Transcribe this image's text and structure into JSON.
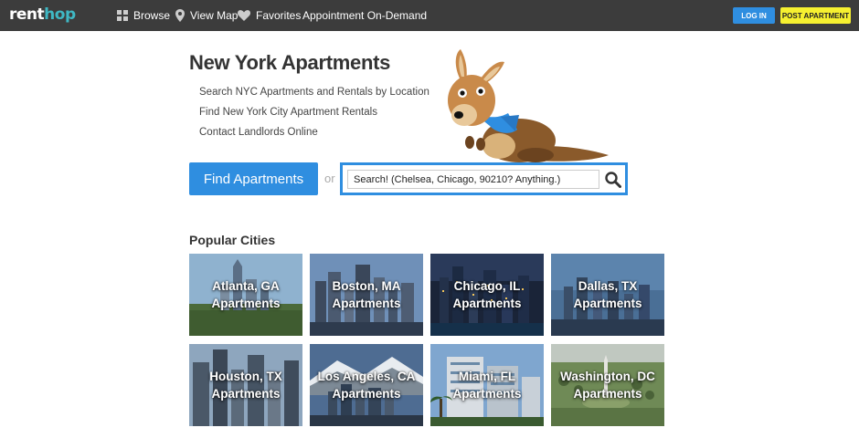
{
  "header": {
    "logo": {
      "part1": "rent",
      "part2": "hop"
    },
    "nav": [
      {
        "label": "Browse",
        "icon": "grid-icon"
      },
      {
        "label": "View Map",
        "icon": "map-pin-icon"
      },
      {
        "label": "Favorites",
        "icon": "heart-icon"
      },
      {
        "label": "Appointment On-Demand"
      }
    ],
    "login_label": "LOG IN",
    "post_label": "POST APARTMENT"
  },
  "hero": {
    "title": "New York Apartments",
    "taglines": [
      "Search NYC Apartments and Rentals by Location",
      "Find New York City Apartment Rentals",
      "Contact Landlords Online"
    ],
    "find_label": "Find Apartments",
    "or_label": "or",
    "search_value": "Search! (Chelsea, Chicago, 90210? Anything.)"
  },
  "popular": {
    "title": "Popular Cities",
    "cities": [
      {
        "line1": "Atlanta, GA",
        "line2": "Apartments"
      },
      {
        "line1": "Boston, MA",
        "line2": "Apartments"
      },
      {
        "line1": "Chicago, IL",
        "line2": "Apartments"
      },
      {
        "line1": "Dallas, TX",
        "line2": "Apartments"
      },
      {
        "line1": "Houston, TX",
        "line2": "Apartments"
      },
      {
        "line1": "Los Angeles, CA",
        "line2": "Apartments"
      },
      {
        "line1": "Miami, FL",
        "line2": "Apartments"
      },
      {
        "line1": "Washington, DC",
        "line2": "Apartments"
      }
    ]
  },
  "colors": {
    "topbar": "#3c3c3c",
    "accent_blue": "#2f8ee0",
    "accent_yellow": "#f6f030",
    "logo_teal": "#3fb8c4"
  }
}
